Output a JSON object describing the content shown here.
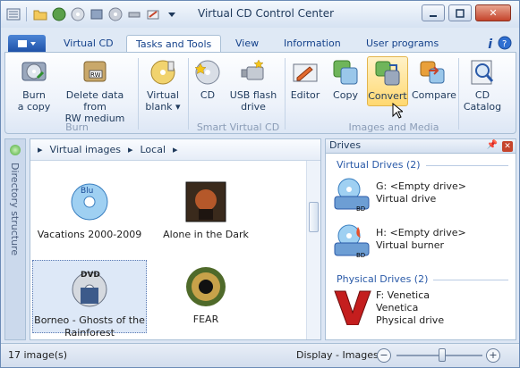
{
  "window": {
    "title": "Virtual CD Control Center"
  },
  "tabs": [
    "Virtual CD",
    "Tasks and Tools",
    "View",
    "Information",
    "User programs"
  ],
  "ribbon": {
    "burn": {
      "burn_a_copy": "Burn\na copy",
      "delete_data": "Delete data from\nRW medium",
      "group_label": "Burn"
    },
    "virtual_blank": "Virtual\nblank ▾",
    "smart_virtual_cd": {
      "cd": "CD",
      "usb": "USB flash\ndrive",
      "group_label": "Smart Virtual CD"
    },
    "images_media": {
      "editor": "Editor",
      "copy": "Copy",
      "convert": "Convert",
      "compare": "Compare",
      "cd_catalog": "CD\nCatalog",
      "group_label": "Images and Media"
    }
  },
  "sidebar": {
    "label": "Directory structure"
  },
  "breadcrumb": {
    "items": [
      "Virtual images",
      "Local"
    ]
  },
  "images": [
    {
      "name": "Vacations 2000-2009"
    },
    {
      "name": "Alone in the Dark"
    },
    {
      "name": "Borneo - Ghosts of the Rainforest"
    },
    {
      "name": "FEAR"
    }
  ],
  "drives": {
    "header": "Drives",
    "virtual_section": "Virtual Drives (2)",
    "physical_section": "Physical Drives (2)",
    "virtual": [
      {
        "line1": "G: <Empty drive>",
        "line2": "Virtual drive"
      },
      {
        "line1": "H: <Empty drive>",
        "line2": "Virtual burner"
      }
    ],
    "physical": [
      {
        "line1": "F: Venetica",
        "line2": "Venetica",
        "line3": "Physical drive"
      }
    ]
  },
  "status": {
    "count": "17 image(s)",
    "display": "Display - Images",
    "zoom_level": 0.5
  },
  "colors": {
    "accent": "#2a5aa8",
    "highlight": "#ffd870"
  }
}
